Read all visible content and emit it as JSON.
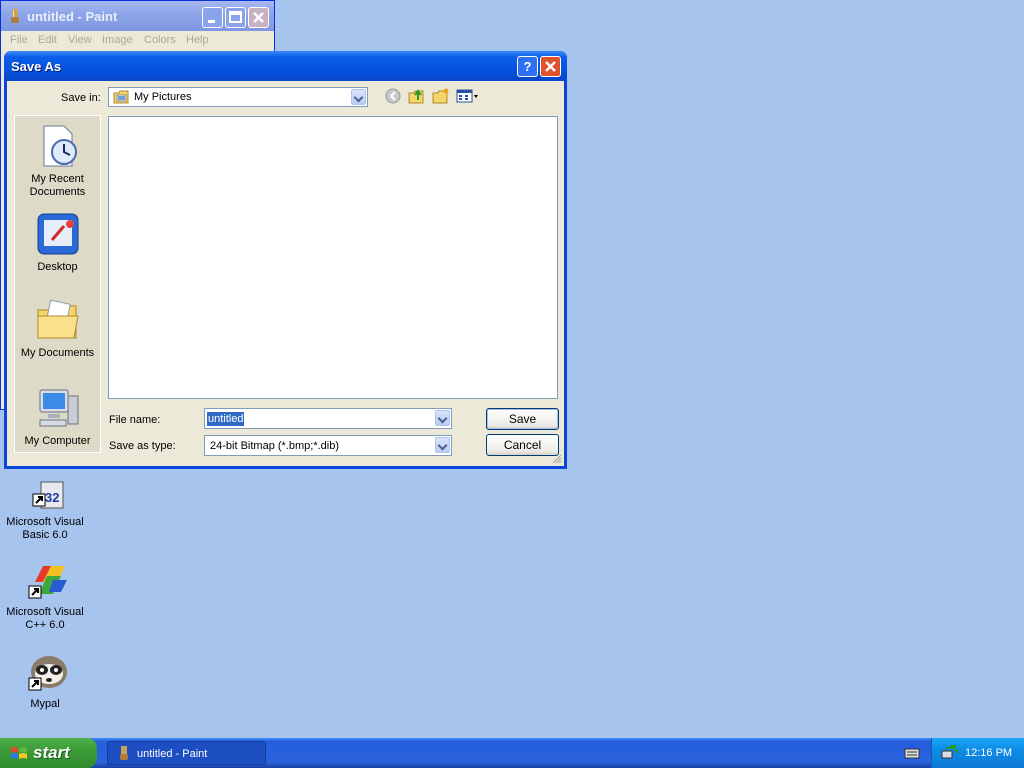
{
  "paint_window": {
    "title": "untitled - Paint",
    "menu": [
      "File",
      "Edit",
      "View",
      "Image",
      "Colors",
      "Help"
    ]
  },
  "dialog": {
    "title": "Save As",
    "save_in_label": "Save in:",
    "save_in_value": "My Pictures",
    "places": [
      {
        "label": "My Recent Documents",
        "icon": "recent-documents-icon"
      },
      {
        "label": "Desktop",
        "icon": "desktop-icon"
      },
      {
        "label": "My Documents",
        "icon": "my-documents-icon"
      },
      {
        "label": "My Computer",
        "icon": "my-computer-icon"
      }
    ],
    "file_name_label": "File name:",
    "file_name_value": "untitled",
    "save_as_type_label": "Save as type:",
    "save_as_type_value": "24-bit Bitmap (*.bmp;*.dib)",
    "save_button": "Save",
    "cancel_button": "Cancel"
  },
  "desktop_icons": [
    {
      "label": "Microsoft Visual Basic 6.0",
      "icon": "visual-basic-icon"
    },
    {
      "label": "Microsoft Visual C++ 6.0",
      "icon": "visual-cpp-icon"
    },
    {
      "label": "Mypal",
      "icon": "mypal-icon"
    }
  ],
  "taskbar": {
    "start_label": "start",
    "tasks": [
      {
        "label": "untitled - Paint"
      }
    ],
    "clock": "12:16 PM"
  },
  "colors": {
    "desktop": "#a6c4ee",
    "dialog_title": "#0553e0",
    "selection": "#316ac5",
    "taskbar": "#245edb",
    "start": "#3c9d38"
  }
}
